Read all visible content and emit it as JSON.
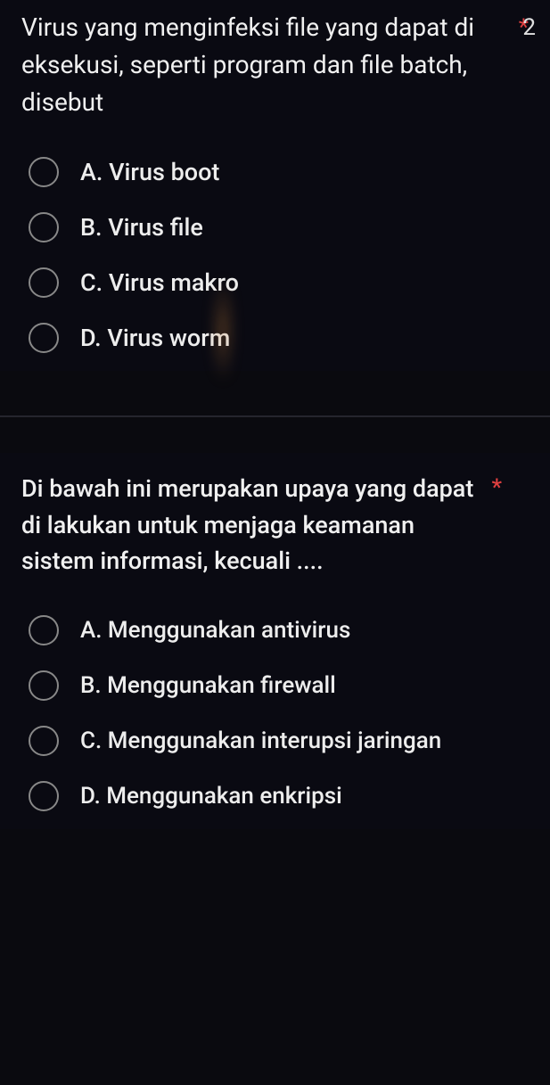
{
  "questions": [
    {
      "text": "Virus yang menginfeksi file yang dapat di eksekusi, seperti program dan file batch, disebut",
      "required": "*",
      "points": "2",
      "options": [
        "A. Virus boot",
        "B. Virus file",
        "C. Virus makro",
        "D. Virus worm"
      ]
    },
    {
      "text": "Di bawah ini merupakan upaya yang dapat di lakukan untuk menjaga keamanan sistem informasi, kecuali ....",
      "required": "*",
      "options": [
        "A. Menggunakan antivirus",
        "B. Menggunakan firewall",
        "C. Menggunakan interupsi jaringan",
        "D. Menggunakan enkripsi"
      ]
    }
  ]
}
